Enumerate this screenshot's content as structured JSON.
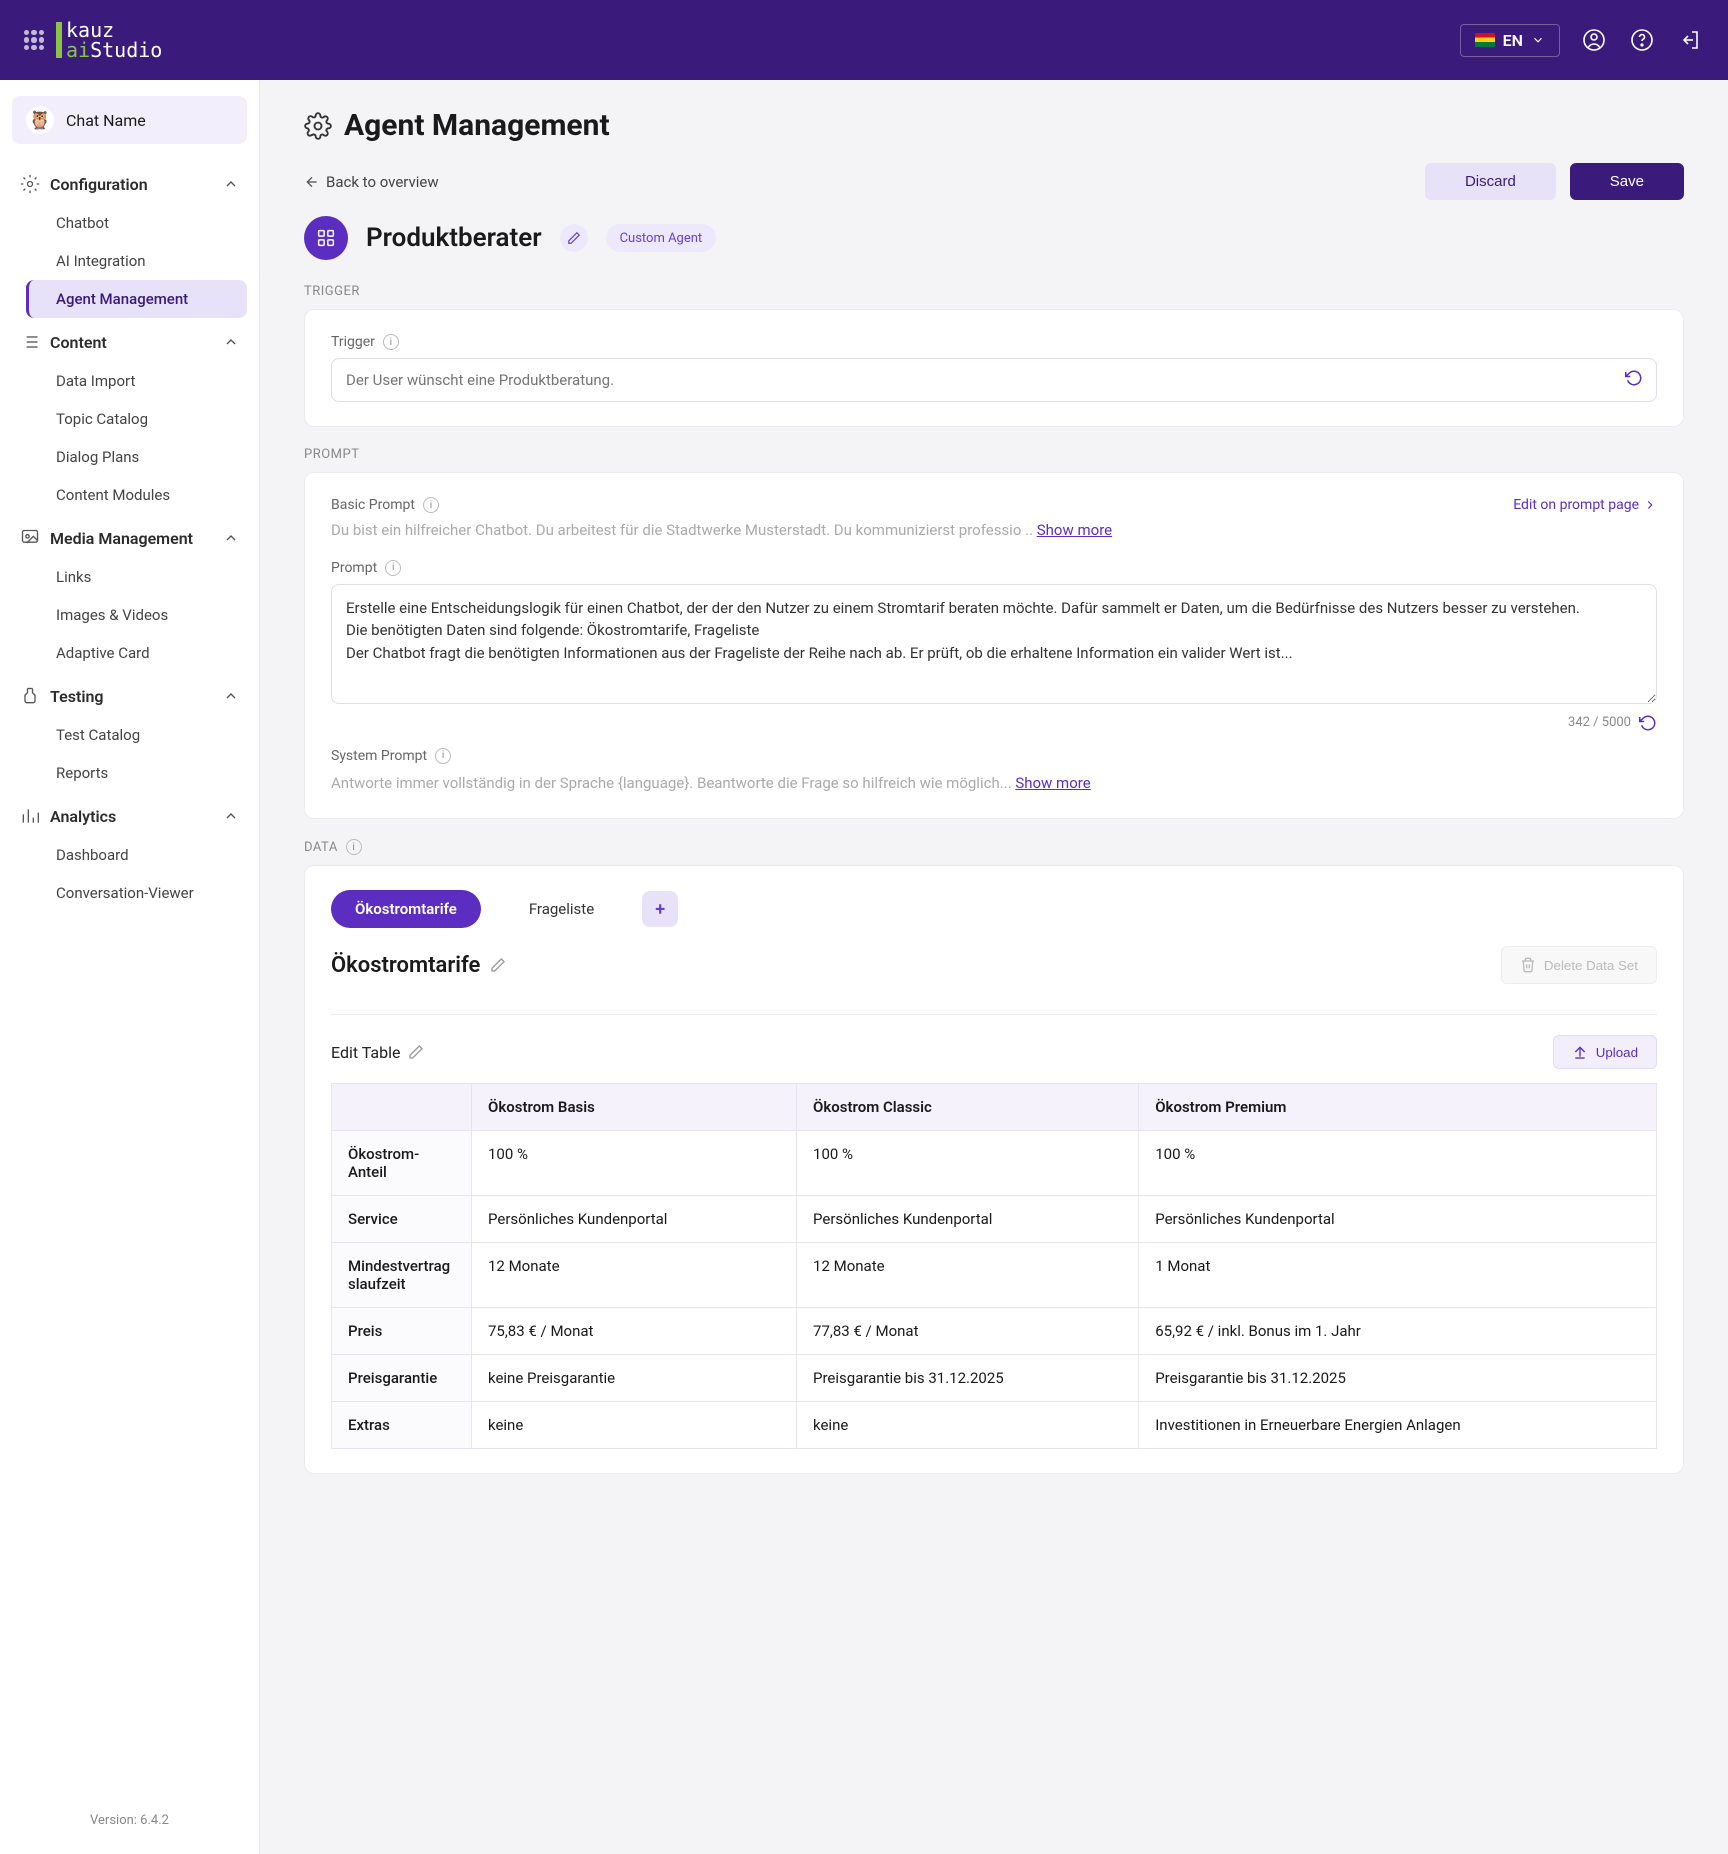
{
  "topbar": {
    "language": "EN"
  },
  "sidebar": {
    "chat_label": "Chat Name",
    "version_label": "Version: 6.4.2",
    "sections": [
      {
        "heading": "Configuration",
        "items": [
          "Chatbot",
          "AI Integration",
          "Agent Management"
        ],
        "active_index": 2
      },
      {
        "heading": "Content",
        "items": [
          "Data Import",
          "Topic Catalog",
          "Dialog Plans",
          "Content Modules"
        ]
      },
      {
        "heading": "Media Management",
        "items": [
          "Links",
          "Images & Videos",
          "Adaptive Card"
        ]
      },
      {
        "heading": "Testing",
        "items": [
          "Test Catalog",
          "Reports"
        ]
      },
      {
        "heading": "Analytics",
        "items": [
          "Dashboard",
          "Conversation-Viewer"
        ]
      }
    ]
  },
  "page": {
    "title": "Agent Management",
    "back_link": "Back to overview",
    "discard_btn": "Discard",
    "save_btn": "Save",
    "agent_name": "Produktberater",
    "agent_tag": "Custom Agent"
  },
  "trigger": {
    "section_label": "TRIGGER",
    "field_label": "Trigger",
    "placeholder": "Der User wünscht eine Produktberatung."
  },
  "prompt": {
    "section_label": "PROMPT",
    "basic_label": "Basic Prompt",
    "edit_link": "Edit on prompt page",
    "basic_text": "Du bist ein hilfreicher Chatbot. Du arbeitest für die Stadtwerke Musterstadt. Du kommunizierst professio ..",
    "show_more": "Show more",
    "prompt_label": "Prompt",
    "prompt_text": "Erstelle eine Entscheidungslogik für einen Chatbot, der der den Nutzer zu einem Stromtarif beraten möchte. Dafür sammelt er Daten, um die Bedürfnisse des Nutzers besser zu verstehen.\nDie benötigten Daten sind folgende: Ökostromtarife, Frageliste\nDer Chatbot fragt die benötigten Informationen aus der Frageliste der Reihe nach ab. Er prüft, ob die erhaltene Information ein valider Wert ist...",
    "char_count": "342 / 5000",
    "system_label": "System Prompt",
    "system_text": "Antworte immer vollständig in der Sprache {language}. Beantworte die Frage so hilfreich wie möglich..."
  },
  "data": {
    "section_label": "DATA",
    "tabs": [
      "Ökostromtarife",
      "Frageliste"
    ],
    "active_tab": 0,
    "dataset_name": "Ökostromtarife",
    "delete_btn": "Delete Data Set",
    "edit_table": "Edit Table",
    "upload_btn": "Upload",
    "table": {
      "columns": [
        "",
        "Ökostrom Basis",
        "Ökostrom Classic",
        "Ökostrom Premium"
      ],
      "rows": [
        [
          "Ökostrom-Anteil",
          "100 %",
          "100 %",
          "100 %"
        ],
        [
          "Service",
          "Persönliches Kundenportal",
          "Persönliches Kundenportal",
          "Persönliches Kundenportal"
        ],
        [
          "Mindestvertragslaufzeit",
          "12 Monate",
          "12 Monate",
          "1 Monat"
        ],
        [
          "Preis",
          "75,83 € / Monat",
          "77,83 € / Monat",
          "65,92 € / inkl. Bonus im 1. Jahr"
        ],
        [
          "Preisgarantie",
          "keine Preisgarantie",
          "Preisgarantie bis 31.12.2025",
          "Preisgarantie bis 31.12.2025"
        ],
        [
          "Extras",
          "keine",
          "keine",
          "Investitionen in Erneuerbare Energien Anlagen"
        ]
      ]
    }
  }
}
